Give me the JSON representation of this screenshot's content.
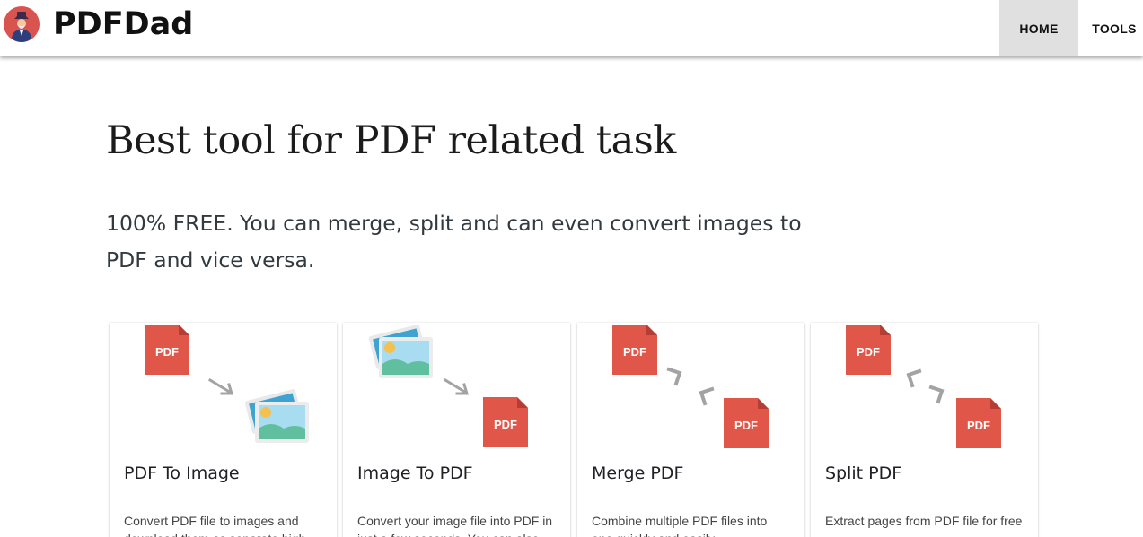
{
  "header": {
    "brand": "PDFDad",
    "logo_icon": "wizard-avatar-icon",
    "nav": [
      {
        "label": "HOME",
        "active": true
      },
      {
        "label": "TOOLS",
        "active": false
      }
    ]
  },
  "hero": {
    "title": "Best tool for PDF related task",
    "subtitle": "100% FREE. You can merge, split and can even convert images to PDF and vice versa."
  },
  "cards": [
    {
      "title": "PDF To Image",
      "description": "Convert PDF file to images and download them as separate high",
      "pdf_badge": "PDF",
      "icons": [
        "pdf-file-icon",
        "arrow-icon",
        "image-icon"
      ]
    },
    {
      "title": "Image To PDF",
      "description": "Convert your image file into PDF in just a few seconds. You can also",
      "pdf_badge": "PDF",
      "icons": [
        "image-icon",
        "arrow-icon",
        "pdf-file-icon"
      ]
    },
    {
      "title": "Merge PDF",
      "description": "Combine multiple PDF files into one quickly and easily",
      "pdf_badge": "PDF",
      "icons": [
        "pdf-file-icon",
        "merge-arrows-icon",
        "pdf-file-icon"
      ]
    },
    {
      "title": "Split PDF",
      "description": "Extract pages from PDF file for free",
      "pdf_badge": "PDF",
      "icons": [
        "pdf-file-icon",
        "split-arrows-icon",
        "pdf-file-icon"
      ]
    }
  ],
  "colors": {
    "pdf_red": "#e0574a",
    "pdf_fold": "#b63d33",
    "nav_active_bg": "#e0e0e0",
    "logo_bg": "#d9534f",
    "arrow_gray": "#a3a3a3",
    "image_sky": "#a8dcf0",
    "image_green": "#5fbf9e",
    "image_sun": "#f5c04d"
  }
}
